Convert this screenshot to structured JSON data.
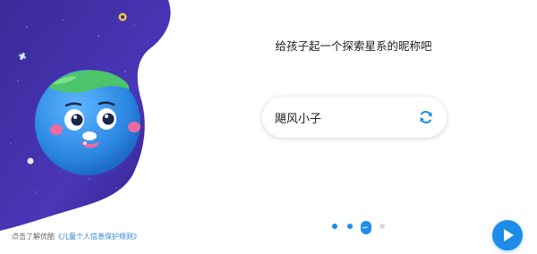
{
  "onboarding": {
    "prompt": "给孩子起一个探索星系的昵称吧",
    "nickname_value": "飓风小子",
    "refresh_icon": "refresh-icon",
    "next_icon": "play-arrow-icon",
    "page_indicator": {
      "total": 4,
      "current": 3
    }
  },
  "footer": {
    "prefix": "点击了解优酷",
    "policy_link": "《儿童个人信息保护规则》"
  },
  "colors": {
    "space_dark": "#2a1d7a",
    "space_mid": "#4533b0",
    "accent_blue": "#1e8ce8",
    "planet_blue": "#2f8ce6",
    "planet_green": "#49c46d"
  }
}
